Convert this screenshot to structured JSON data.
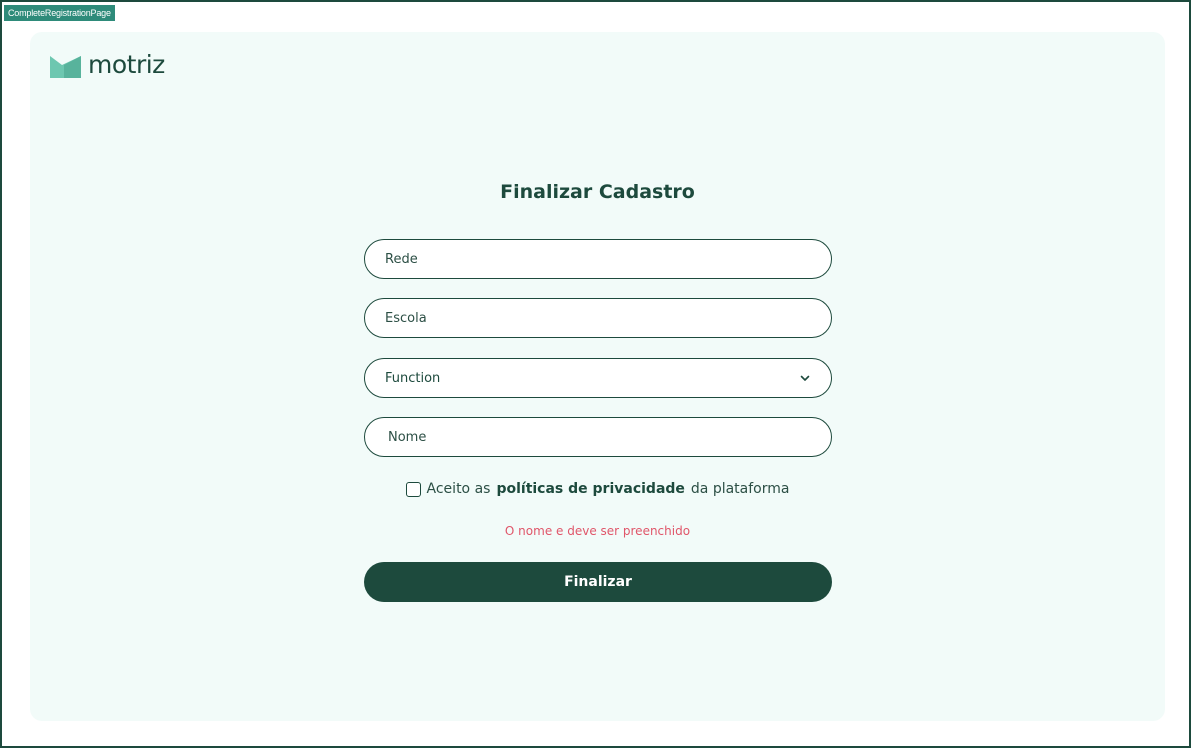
{
  "page": {
    "frame_label": "CompleteRegistrationPage"
  },
  "brand": {
    "name": "motriz",
    "logo_icon": "motriz-logo-icon",
    "color": "#1d4a3d",
    "accent": "#6dc7b0"
  },
  "form": {
    "title": "Finalizar Cadastro",
    "rede": {
      "placeholder": "Rede",
      "value": ""
    },
    "escola": {
      "placeholder": "Escola",
      "value": ""
    },
    "function_select": {
      "selected": "Function",
      "icon": "chevron-down-icon"
    },
    "nome": {
      "placeholder": "Nome",
      "value": ""
    },
    "consent": {
      "prefix": "Aceito as",
      "link": "políticas de privacidade",
      "suffix": "da plataforma",
      "checked": false
    },
    "error": "O nome e deve ser preenchido",
    "submit_label": "Finalizar"
  },
  "colors": {
    "primary": "#1d4a3d",
    "background": "#f2fbf9",
    "error": "#e0566a",
    "label_badge": "#2e8b7a"
  }
}
